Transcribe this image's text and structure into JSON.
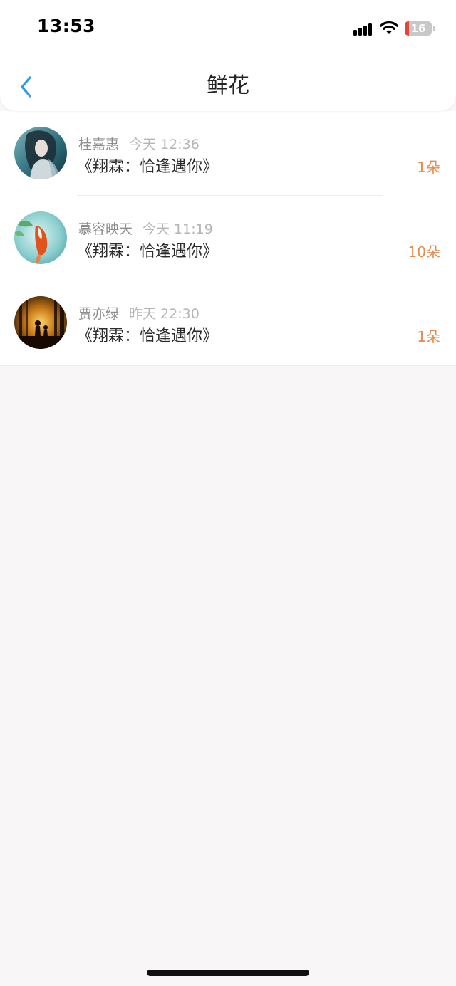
{
  "status_bar": {
    "time": "13:53",
    "battery": "16",
    "battery_level": 0.16,
    "icons": [
      "signal-icon",
      "wifi-icon",
      "battery-icon"
    ]
  },
  "nav": {
    "back_icon": "chevron-left-icon",
    "title": "鲜花"
  },
  "colors": {
    "accent": "#2f9be8",
    "count": "#e88a4b",
    "background": "#f8f6f7"
  },
  "items": [
    {
      "name": "桂嘉惠",
      "time": "今天 12:36",
      "book": "《翔霖：恰逢遇你》",
      "count": "1朵"
    },
    {
      "name": "慕容映天",
      "time": "今天 11:19",
      "book": "《翔霖：恰逢遇你》",
      "count": "10朵"
    },
    {
      "name": "贾亦绿",
      "time": "昨天 22:30",
      "book": "《翔霖：恰逢遇你》",
      "count": "1朵"
    }
  ]
}
